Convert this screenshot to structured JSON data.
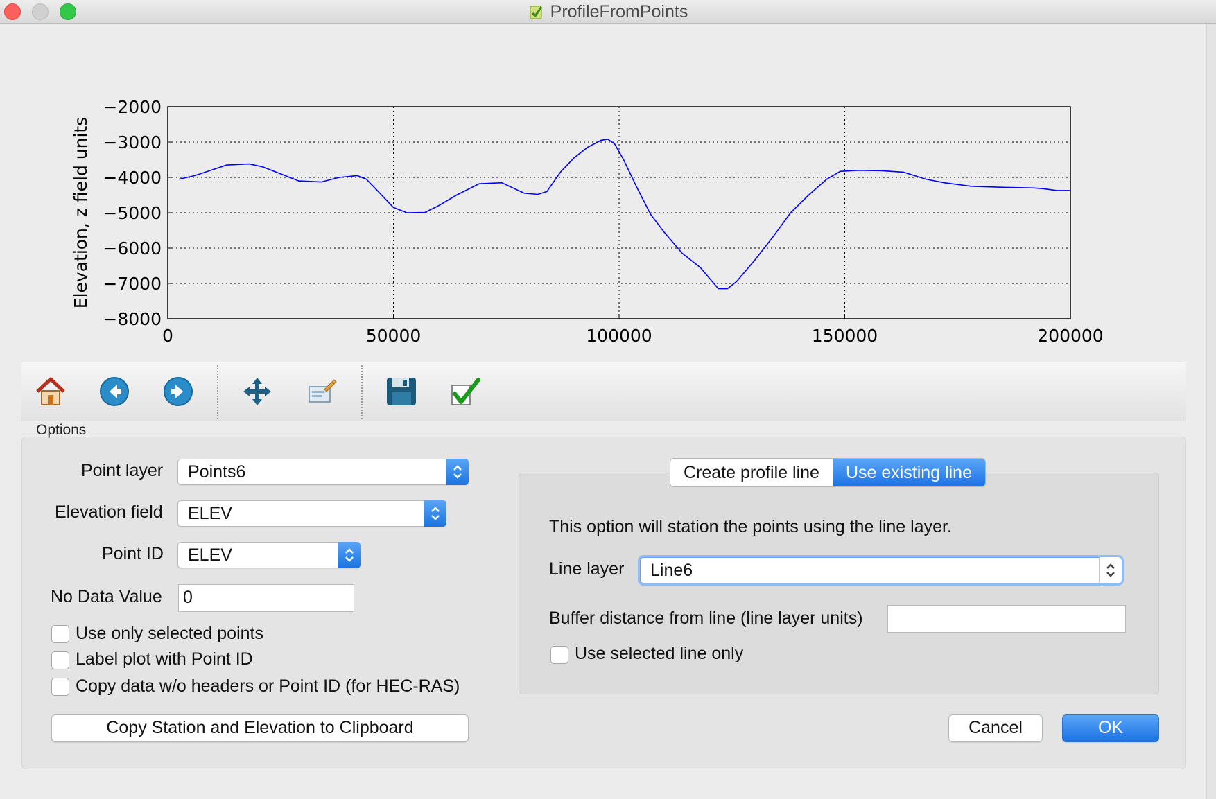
{
  "window": {
    "title": "ProfileFromPoints"
  },
  "chart_data": {
    "type": "line",
    "title": "",
    "xlabel": "",
    "ylabel": "Elevation, z field units",
    "xlim": [
      0,
      200000
    ],
    "ylim": [
      -8000,
      -2000
    ],
    "xticks": [
      0,
      50000,
      100000,
      150000,
      200000
    ],
    "yticks": [
      -2000,
      -3000,
      -4000,
      -5000,
      -6000,
      -7000,
      -8000
    ],
    "xtick_labels": [
      "0",
      "50000",
      "100000",
      "150000",
      "200000"
    ],
    "ytick_labels": [
      "−2000",
      "−3000",
      "−4000",
      "−5000",
      "−6000",
      "−7000",
      "−8000"
    ],
    "grid": true,
    "series": [
      {
        "color": "#0000ff",
        "x": [
          2500,
          6000,
          10000,
          13000,
          18000,
          21000,
          25000,
          29000,
          34000,
          38000,
          42000,
          44000,
          47000,
          50000,
          53000,
          57000,
          60000,
          64000,
          69000,
          74000,
          79000,
          82000,
          84000,
          87000,
          90000,
          93000,
          96000,
          97500,
          99000,
          101000,
          104000,
          107000,
          110000,
          114000,
          118000,
          120000,
          122000,
          124000,
          126000,
          130000,
          134000,
          138000,
          142000,
          146000,
          149000,
          153000,
          158000,
          163000,
          168000,
          172000,
          178000,
          185000,
          192000,
          194000,
          197000,
          200000
        ],
        "y": [
          -4050,
          -3950,
          -3780,
          -3650,
          -3620,
          -3700,
          -3900,
          -4100,
          -4130,
          -4000,
          -3950,
          -4050,
          -4450,
          -4850,
          -5000,
          -4990,
          -4800,
          -4500,
          -4180,
          -4150,
          -4450,
          -4480,
          -4400,
          -3850,
          -3450,
          -3150,
          -2950,
          -2920,
          -3050,
          -3500,
          -4300,
          -5050,
          -5550,
          -6150,
          -6550,
          -6850,
          -7150,
          -7150,
          -6950,
          -6350,
          -5700,
          -5000,
          -4500,
          -4050,
          -3830,
          -3800,
          -3810,
          -3850,
          -4050,
          -4150,
          -4250,
          -4280,
          -4300,
          -4320,
          -4370,
          -4370
        ]
      }
    ]
  },
  "toolbar": {
    "buttons": [
      {
        "name": "home-button",
        "icon": "home-icon"
      },
      {
        "name": "back-button",
        "icon": "arrow-left-icon"
      },
      {
        "name": "forward-button",
        "icon": "arrow-right-icon"
      },
      {
        "name": "pan-button",
        "icon": "move-icon"
      },
      {
        "name": "configure-subplots-button",
        "icon": "edit-axis-icon"
      },
      {
        "name": "save-figure-button",
        "icon": "floppy-disk-icon"
      },
      {
        "name": "apply-button",
        "icon": "checkmark-icon"
      }
    ]
  },
  "options": {
    "group_label": "Options",
    "point_layer": {
      "label": "Point layer",
      "value": "Points6"
    },
    "elevation_field": {
      "label": "Elevation field",
      "value": "ELEV"
    },
    "point_id": {
      "label": "Point ID",
      "value": "ELEV"
    },
    "no_data_value": {
      "label": "No Data Value",
      "value": "0"
    },
    "checkboxes": [
      {
        "label": "Use only selected points",
        "checked": false
      },
      {
        "label": "Label plot with Point ID",
        "checked": false
      },
      {
        "label": "Copy data w/o headers or Point ID (for HEC-RAS)",
        "checked": false
      }
    ],
    "copy_button": "Copy Station and Elevation to Clipboard"
  },
  "tabs": {
    "items": [
      "Create profile line",
      "Use existing line"
    ],
    "active": 1,
    "description": "This option will station the points using the line layer.",
    "line_layer": {
      "label": "Line layer",
      "value": "Line6"
    },
    "buffer": {
      "label": "Buffer distance from line (line layer units)",
      "value": ""
    },
    "selected_only": {
      "label": "Use selected line only",
      "checked": false
    }
  },
  "dialog_buttons": {
    "cancel": "Cancel",
    "ok": "OK"
  },
  "colors": {
    "accent": "#1c72e3",
    "plot_line": "#0000ff"
  }
}
